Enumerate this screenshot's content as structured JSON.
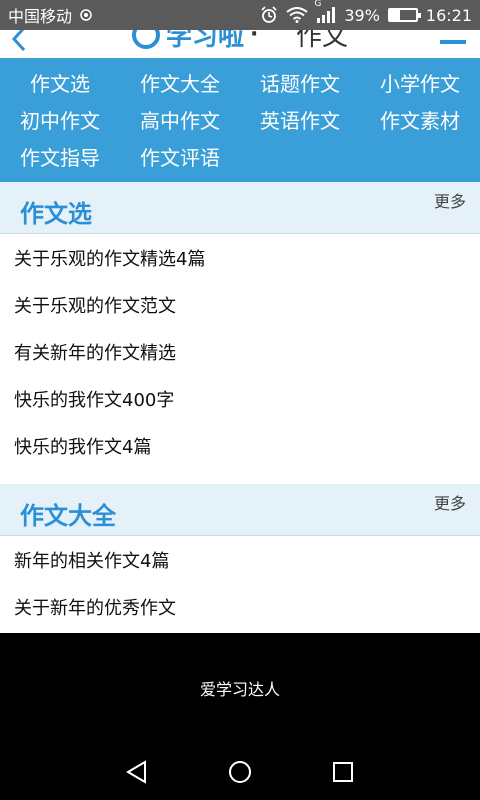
{
  "status_bar": {
    "carrier": "中国移动",
    "signal_type": "G",
    "battery_percent": "39%",
    "battery_level": 0.39,
    "time": "16:21"
  },
  "header": {
    "logo_text": "学习啦",
    "separator": "·",
    "page_title": "作文",
    "back_icon": "chevron-left-icon",
    "menu_icon": "hamburger-menu-icon"
  },
  "categories": [
    {
      "label": "作文选"
    },
    {
      "label": "作文大全"
    },
    {
      "label": "话题作文"
    },
    {
      "label": "小学作文"
    },
    {
      "label": "初中作文"
    },
    {
      "label": "高中作文"
    },
    {
      "label": "英语作文"
    },
    {
      "label": "作文素材"
    },
    {
      "label": "作文指导"
    },
    {
      "label": "作文评语"
    }
  ],
  "sections": [
    {
      "title": "作文选",
      "more_label": "更多",
      "articles": [
        "关于乐观的作文精选4篇",
        "关于乐观的作文范文",
        "有关新年的作文精选",
        "快乐的我作文400字",
        "快乐的我作文4篇"
      ]
    },
    {
      "title": "作文大全",
      "more_label": "更多",
      "articles": [
        "新年的相关作文4篇",
        "关于新年的优秀作文"
      ]
    }
  ],
  "footer": {
    "banner_text": "爱学习达人"
  },
  "colors": {
    "accent": "#2b8fd6",
    "category_bg": "#3a9fd8",
    "section_header_bg": "#e4f1f9",
    "status_bar_bg": "#5a5a5a"
  }
}
